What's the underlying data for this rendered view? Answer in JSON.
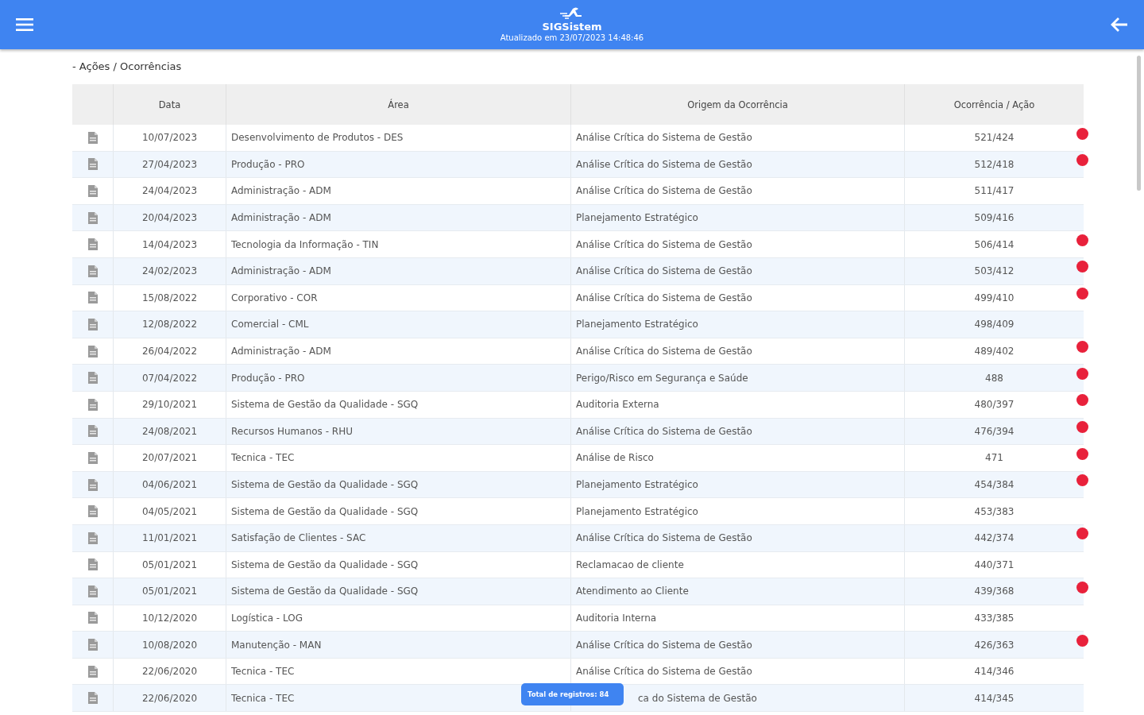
{
  "header": {
    "brand": "SIGSistem",
    "updated": "Atualizado em 23/07/2023 14:48:46"
  },
  "section_title": "- Ações / Ocorrências",
  "table": {
    "columns": [
      "Data",
      "Área",
      "Origem da Ocorrência",
      "Ocorrência / Ação"
    ],
    "rows": [
      {
        "date": "10/07/2023",
        "area": "Desenvolvimento de Produtos - DES",
        "origin": "Análise Crítica do Sistema de Gestão",
        "code": "521/424",
        "alert": true
      },
      {
        "date": "27/04/2023",
        "area": "Produção - PRO",
        "origin": "Análise Crítica do Sistema de Gestão",
        "code": "512/418",
        "alert": true
      },
      {
        "date": "24/04/2023",
        "area": "Administração - ADM",
        "origin": "Análise Crítica do Sistema de Gestão",
        "code": "511/417",
        "alert": false
      },
      {
        "date": "20/04/2023",
        "area": "Administração - ADM",
        "origin": "Planejamento Estratégico",
        "code": "509/416",
        "alert": false
      },
      {
        "date": "14/04/2023",
        "area": "Tecnologia da Informação - TIN",
        "origin": "Análise Crítica do Sistema de Gestão",
        "code": "506/414",
        "alert": true
      },
      {
        "date": "24/02/2023",
        "area": "Administração - ADM",
        "origin": "Análise Crítica do Sistema de Gestão",
        "code": "503/412",
        "alert": true
      },
      {
        "date": "15/08/2022",
        "area": "Corporativo - COR",
        "origin": "Análise Crítica do Sistema de Gestão",
        "code": "499/410",
        "alert": true
      },
      {
        "date": "12/08/2022",
        "area": "Comercial - CML",
        "origin": "Planejamento Estratégico",
        "code": "498/409",
        "alert": false
      },
      {
        "date": "26/04/2022",
        "area": "Administração - ADM",
        "origin": "Análise Crítica do Sistema de Gestão",
        "code": "489/402",
        "alert": true
      },
      {
        "date": "07/04/2022",
        "area": "Produção - PRO",
        "origin": "Perigo/Risco em Segurança e Saúde",
        "code": "488",
        "alert": true
      },
      {
        "date": "29/10/2021",
        "area": "Sistema de Gestão da Qualidade - SGQ",
        "origin": "Auditoria Externa",
        "code": "480/397",
        "alert": true
      },
      {
        "date": "24/08/2021",
        "area": "Recursos Humanos - RHU",
        "origin": "Análise Crítica do Sistema de Gestão",
        "code": "476/394",
        "alert": true
      },
      {
        "date": "20/07/2021",
        "area": "Tecnica - TEC",
        "origin": "Análise de Risco",
        "code": "471",
        "alert": true
      },
      {
        "date": "04/06/2021",
        "area": "Sistema de Gestão da Qualidade - SGQ",
        "origin": "Planejamento Estratégico",
        "code": "454/384",
        "alert": true
      },
      {
        "date": "04/05/2021",
        "area": "Sistema de Gestão da Qualidade - SGQ",
        "origin": "Planejamento Estratégico",
        "code": "453/383",
        "alert": false
      },
      {
        "date": "11/01/2021",
        "area": "Satisfação de Clientes - SAC",
        "origin": "Análise Crítica do Sistema de Gestão",
        "code": "442/374",
        "alert": true
      },
      {
        "date": "05/01/2021",
        "area": "Sistema de Gestão da Qualidade - SGQ",
        "origin": "Reclamacao de cliente",
        "code": "440/371",
        "alert": false
      },
      {
        "date": "05/01/2021",
        "area": "Sistema de Gestão da Qualidade - SGQ",
        "origin": "Atendimento ao Cliente",
        "code": "439/368",
        "alert": true
      },
      {
        "date": "10/12/2020",
        "area": "Logística - LOG",
        "origin": "Auditoria Interna",
        "code": "433/385",
        "alert": false
      },
      {
        "date": "10/08/2020",
        "area": "Manutenção - MAN",
        "origin": "Análise Crítica do Sistema de Gestão",
        "code": "426/363",
        "alert": true
      },
      {
        "date": "22/06/2020",
        "area": "Tecnica - TEC",
        "origin": "Análise Crítica do Sistema de Gestão",
        "code": "414/346",
        "alert": false
      },
      {
        "date": "22/06/2020",
        "area": "Tecnica - TEC",
        "origin": "ca do Sistema de Gestão",
        "code": "414/345",
        "alert": false,
        "covered": true
      }
    ]
  },
  "total_badge": "Total de registros: 84"
}
